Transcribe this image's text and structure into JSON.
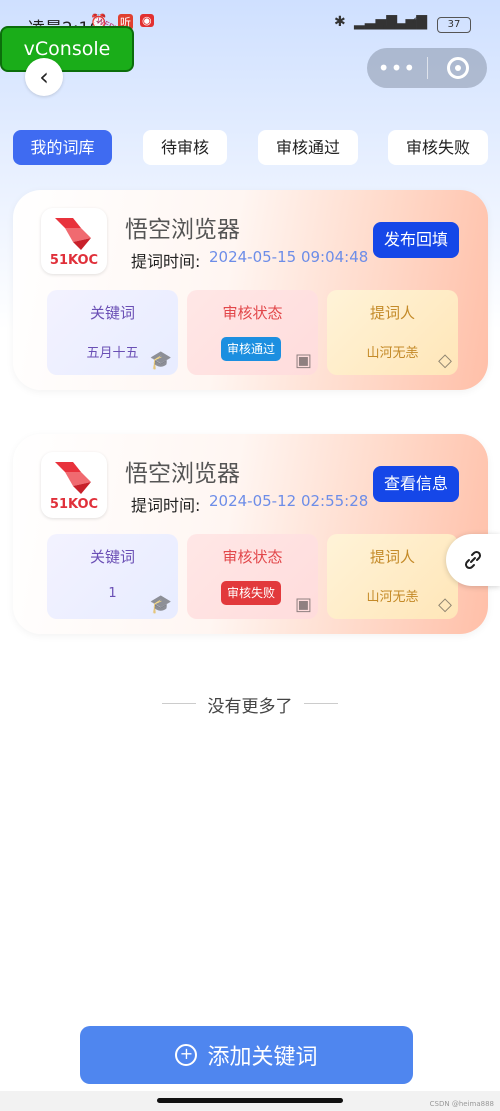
{
  "status_bar": {
    "time": "凌晨2:16",
    "battery": "37",
    "icons": [
      "alarm-icon",
      "news-app-icon",
      "netease-icon",
      "bluetooth-icon",
      "signal-icon",
      "signal-icon",
      "wifi-icon",
      "battery-icon"
    ],
    "webview_tag": "WEBVIEW"
  },
  "vconsole": {
    "label": "vConsole"
  },
  "nav": {
    "back_glyph": "‹",
    "more_glyph": "•••"
  },
  "tabs": [
    {
      "label": "我的词库",
      "active": true
    },
    {
      "label": "待审核",
      "active": false
    },
    {
      "label": "审核通过",
      "active": false
    },
    {
      "label": "审核失败",
      "active": false
    }
  ],
  "cards": [
    {
      "logo_text": "51KOC",
      "app_name": "悟空浏览器",
      "time_label": "提词时间:",
      "time_value": "2024-05-15 09:04:48",
      "action_label": "发布回填",
      "keyword_title": "关键词",
      "keyword_value": "五月十五",
      "status_title": "审核状态",
      "status_value": "审核通过",
      "status_color": "#1c8fe0",
      "person_title": "提词人",
      "person_value": "山河无恙"
    },
    {
      "logo_text": "51KOC",
      "app_name": "悟空浏览器",
      "time_label": "提词时间:",
      "time_value": "2024-05-12 02:55:28",
      "action_label": "查看信息",
      "keyword_title": "关键词",
      "keyword_value": "1",
      "status_title": "审核状态",
      "status_value": "审核失败",
      "status_color": "#e2393c",
      "person_title": "提词人",
      "person_value": "山河无恙"
    }
  ],
  "list_end": "没有更多了",
  "add_button": {
    "label": "添加关键词"
  },
  "watermark": "CSDN @heima888",
  "colors": {
    "primary": "#3f6bf1",
    "action": "#1547e8",
    "add": "#4f86ef"
  }
}
